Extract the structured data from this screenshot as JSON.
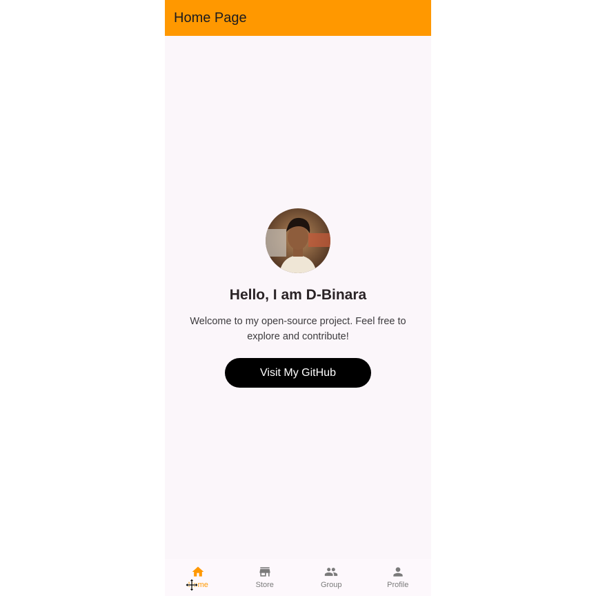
{
  "app": {
    "title": "Home Page",
    "accent_color": "#ff9800",
    "background_color": "#fbf6fa"
  },
  "profile": {
    "avatar": "profile-photo",
    "greeting": "Hello, I am D-Binara",
    "welcome": "Welcome to my open-source project. Feel free to explore and contribute!",
    "button_label": "Visit My GitHub"
  },
  "bottom_nav": {
    "items": [
      {
        "label": "Home",
        "icon": "home-icon",
        "active": true
      },
      {
        "label": "Store",
        "icon": "store-icon",
        "active": false
      },
      {
        "label": "Group",
        "icon": "group-icon",
        "active": false
      },
      {
        "label": "Profile",
        "icon": "person-icon",
        "active": false
      }
    ]
  }
}
